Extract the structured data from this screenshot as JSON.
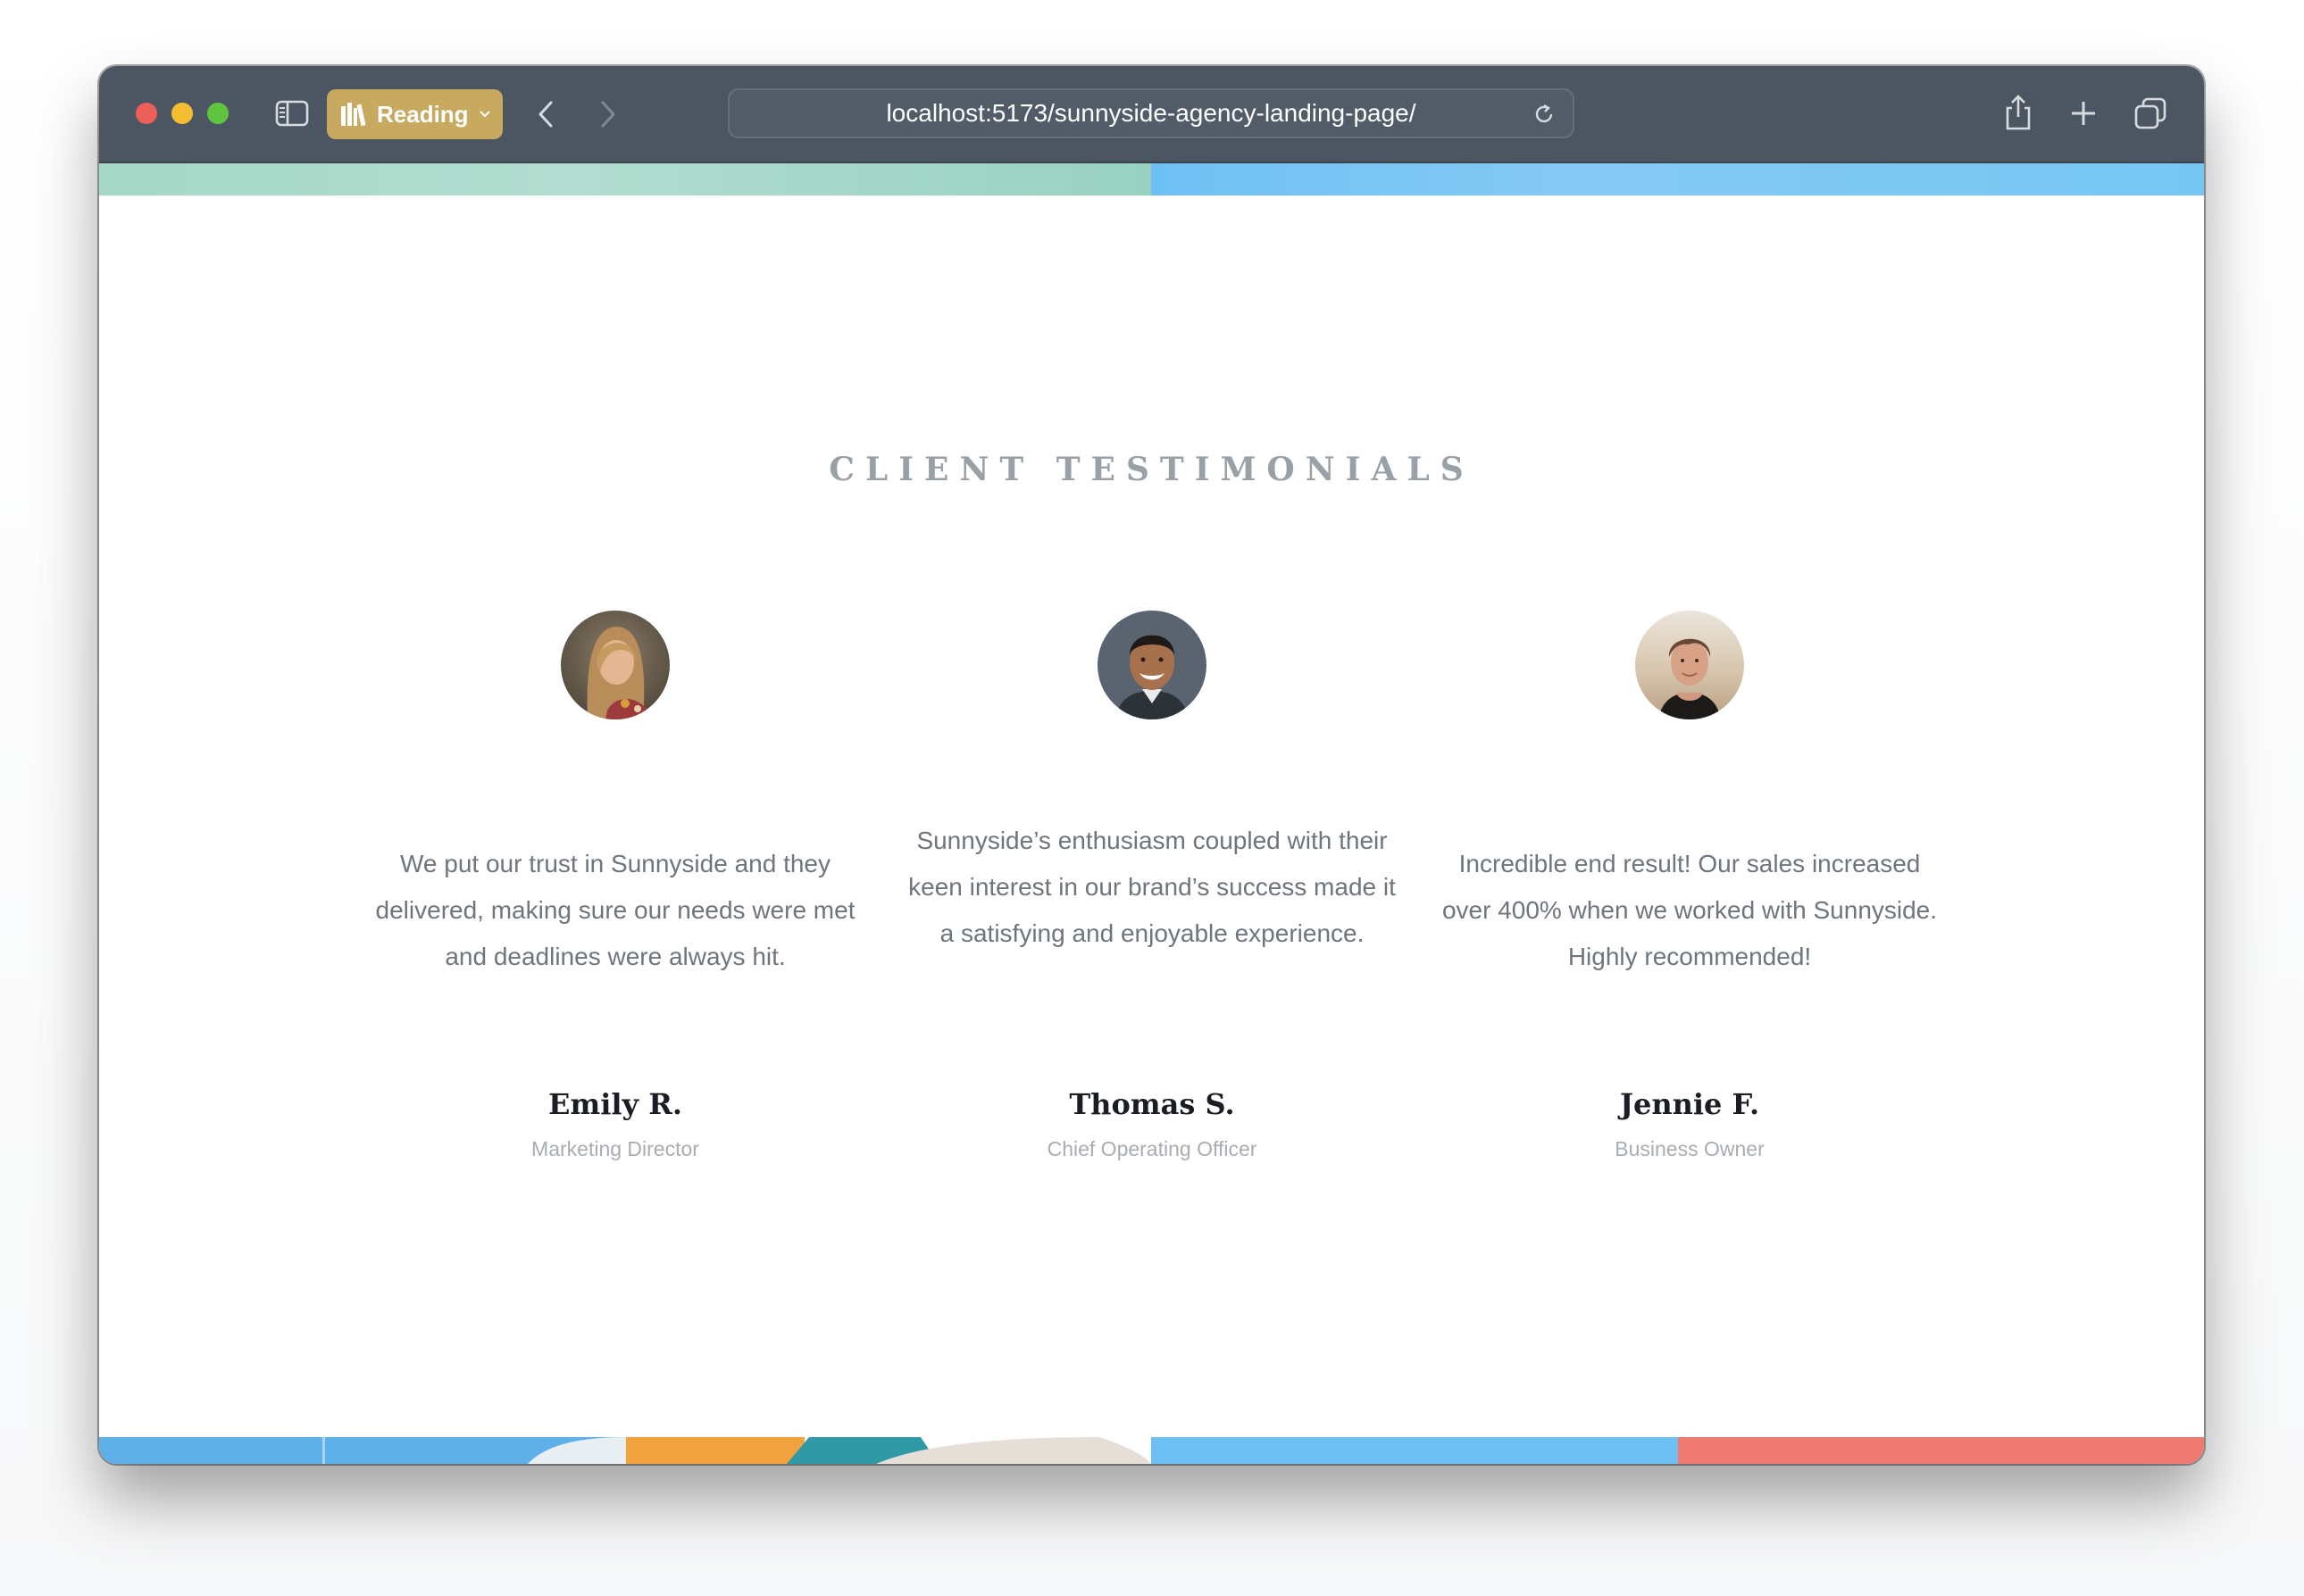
{
  "browser": {
    "reading_label": "Reading",
    "url": "localhost:5173/sunnyside-agency-landing-page/"
  },
  "section": {
    "title": "CLIENT TESTIMONIALS"
  },
  "testimonials": [
    {
      "quote": "We put our trust in Sunnyside and they delivered, making sure our needs were met and deadlines were always hit.",
      "name": "Emily R.",
      "role": "Marketing Director"
    },
    {
      "quote": "Sunnyside’s enthusiasm coupled with their keen interest in our brand’s success made it a satisfying and enjoyable experience.",
      "name": "Thomas S.",
      "role": "Chief Operating Officer"
    },
    {
      "quote": "Incredible end result! Our sales increased over 400% when we worked with Sunnyside. Highly recommended!",
      "name": "Jennie F.",
      "role": "Business Owner"
    }
  ],
  "colors": {
    "toolbar": "#4c5663",
    "reading_button": "#c8a960",
    "title_gray": "#9aa1a6",
    "quote_gray": "#6e757d",
    "name_dark": "#1a1d21",
    "role_gray": "#a8adb2",
    "band_green": "#a5d8c7",
    "band_blue": "#76c6f3",
    "band_orange": "#f0a23e",
    "band_red": "#ee7a72"
  }
}
